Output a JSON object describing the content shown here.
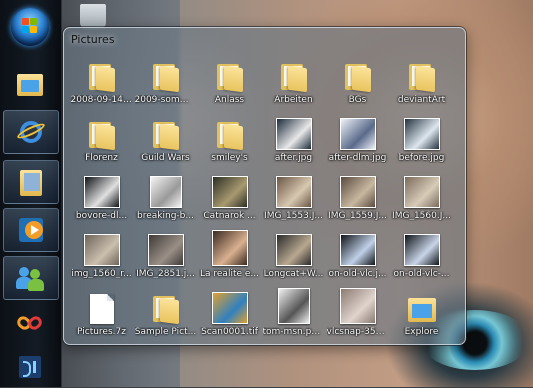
{
  "panel": {
    "title": "Pictures",
    "items": [
      {
        "label": "2008-09-14 ...",
        "icon": "folder-icon"
      },
      {
        "label": "2009-somm...",
        "icon": "folder-icon"
      },
      {
        "label": "Anlass",
        "icon": "folder-icon"
      },
      {
        "label": "Arbeiten",
        "icon": "folder-icon"
      },
      {
        "label": "BGs",
        "icon": "folder-icon"
      },
      {
        "label": "deviantArt",
        "icon": "folder-icon"
      },
      {
        "label": "Florenz",
        "icon": "folder-icon"
      },
      {
        "label": "Guild Wars",
        "icon": "folder-icon"
      },
      {
        "label": "smiley's",
        "icon": "folder-icon"
      },
      {
        "label": "after.jpg",
        "icon": "image-thumbnail-icon"
      },
      {
        "label": "after-dlm.jpg",
        "icon": "image-thumbnail-icon"
      },
      {
        "label": "before.jpg",
        "icon": "image-thumbnail-icon"
      },
      {
        "label": "bovore-dl...",
        "icon": "image-thumbnail-icon"
      },
      {
        "label": "breaking-b...",
        "icon": "image-thumbnail-icon"
      },
      {
        "label": "Catnarok ...",
        "icon": "image-thumbnail-icon"
      },
      {
        "label": "IMG_1553.J...",
        "icon": "image-thumbnail-icon"
      },
      {
        "label": "IMG_1559.J...",
        "icon": "image-thumbnail-icon"
      },
      {
        "label": "IMG_1560.J...",
        "icon": "image-thumbnail-icon"
      },
      {
        "label": "img_1560_r...",
        "icon": "image-thumbnail-icon"
      },
      {
        "label": "IMG_2851.j...",
        "icon": "image-thumbnail-icon"
      },
      {
        "label": "La realite e...",
        "icon": "image-thumbnail-icon"
      },
      {
        "label": "Longcat+W...",
        "icon": "image-thumbnail-icon"
      },
      {
        "label": "on-old-vlc.j...",
        "icon": "image-thumbnail-icon"
      },
      {
        "label": "on-old-vlc-...",
        "icon": "image-thumbnail-icon"
      },
      {
        "label": "Pictures.7z",
        "icon": "file-icon"
      },
      {
        "label": "Sample Pict...",
        "icon": "folder-icon"
      },
      {
        "label": "Scan0001.tif",
        "icon": "image-thumbnail-icon"
      },
      {
        "label": "tom-msn.pn...",
        "icon": "image-thumbnail-icon"
      },
      {
        "label": "vlcsnap-356...",
        "icon": "image-thumbnail-icon"
      },
      {
        "label": "Explore",
        "icon": "explorer-icon"
      }
    ]
  },
  "taskbar": {
    "buttons": [
      "start-orb",
      "explorer-icon",
      "internet-explorer-icon",
      "explorer-window-icon",
      "media-player-icon",
      "messenger-icon",
      "app-icon",
      "dreamweaver-icon"
    ]
  },
  "colors": {
    "panel_tint": "#697884",
    "taskbar": "#10151c",
    "folder": "#f0d070"
  }
}
